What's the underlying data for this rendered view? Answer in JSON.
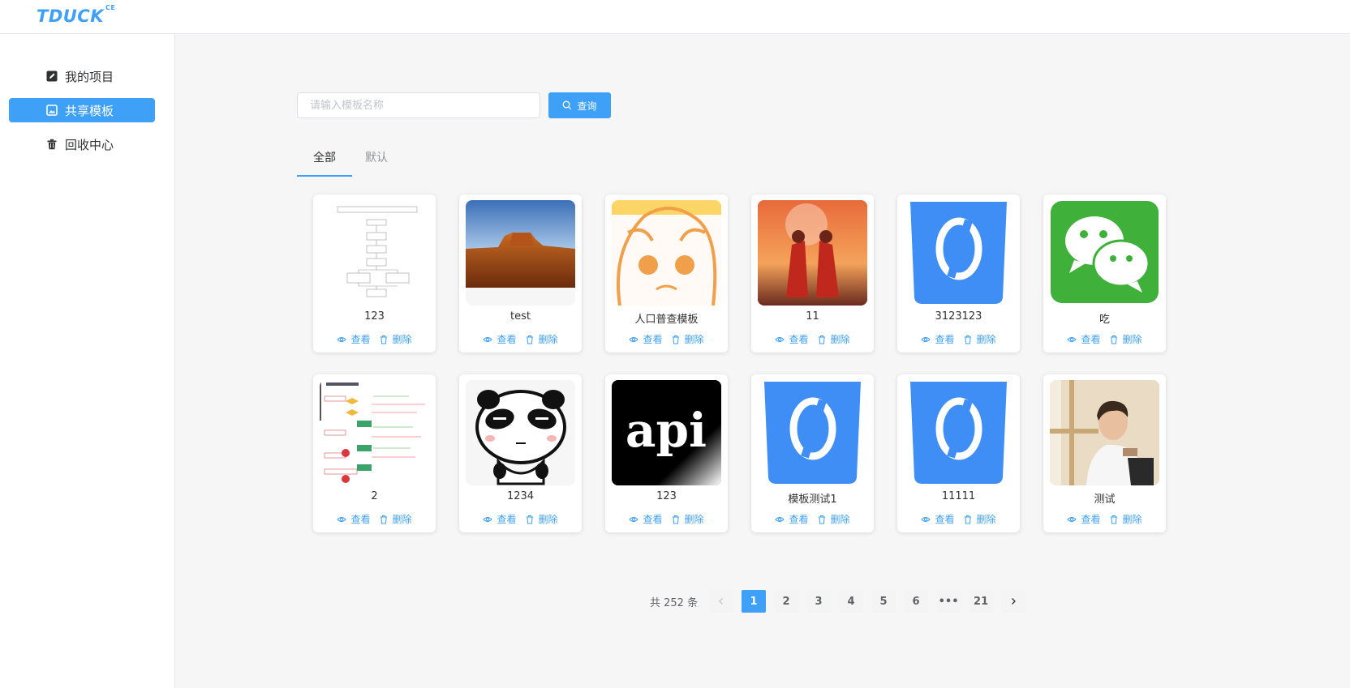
{
  "header": {
    "logo": "TDUCK",
    "logo_sup": "CE"
  },
  "sidebar": {
    "items": [
      {
        "label": "我的项目",
        "icon": "edit-icon"
      },
      {
        "label": "共享模板",
        "icon": "picture-icon",
        "active": true
      },
      {
        "label": "回收中心",
        "icon": "trash-icon"
      }
    ]
  },
  "search": {
    "placeholder": "请输入模板名称",
    "value": "",
    "button_label": "查询"
  },
  "tabs": [
    {
      "label": "全部",
      "active": true
    },
    {
      "label": "默认"
    }
  ],
  "card_actions": {
    "view": "查看",
    "delete": "删除"
  },
  "templates": [
    {
      "name": "123",
      "thumb": "flowchart-document"
    },
    {
      "name": "test",
      "thumb": "desert-butte-photo"
    },
    {
      "name": "人口普查模板",
      "thumb": "cartoon-face-drawing"
    },
    {
      "name": "11",
      "thumb": "couple-sunset-illustration"
    },
    {
      "name": "3123123",
      "thumb": "tduck-app-icon"
    },
    {
      "name": "吃",
      "thumb": "wechat-icon"
    },
    {
      "name": "2",
      "thumb": "flowchart-diagram"
    },
    {
      "name": "1234",
      "thumb": "panda-cartoon"
    },
    {
      "name": "123",
      "thumb": "api-logo"
    },
    {
      "name": "模板测试1",
      "thumb": "tduck-app-icon"
    },
    {
      "name": "11111",
      "thumb": "tduck-app-icon"
    },
    {
      "name": "测试",
      "thumb": "person-photo"
    }
  ],
  "pagination": {
    "total_text": "共 252 条",
    "pages": [
      "1",
      "2",
      "3",
      "4",
      "5",
      "6",
      "•••",
      "21"
    ],
    "current": "1"
  },
  "colors": {
    "accent": "#3ea0f6",
    "background": "#f6f6f6"
  }
}
